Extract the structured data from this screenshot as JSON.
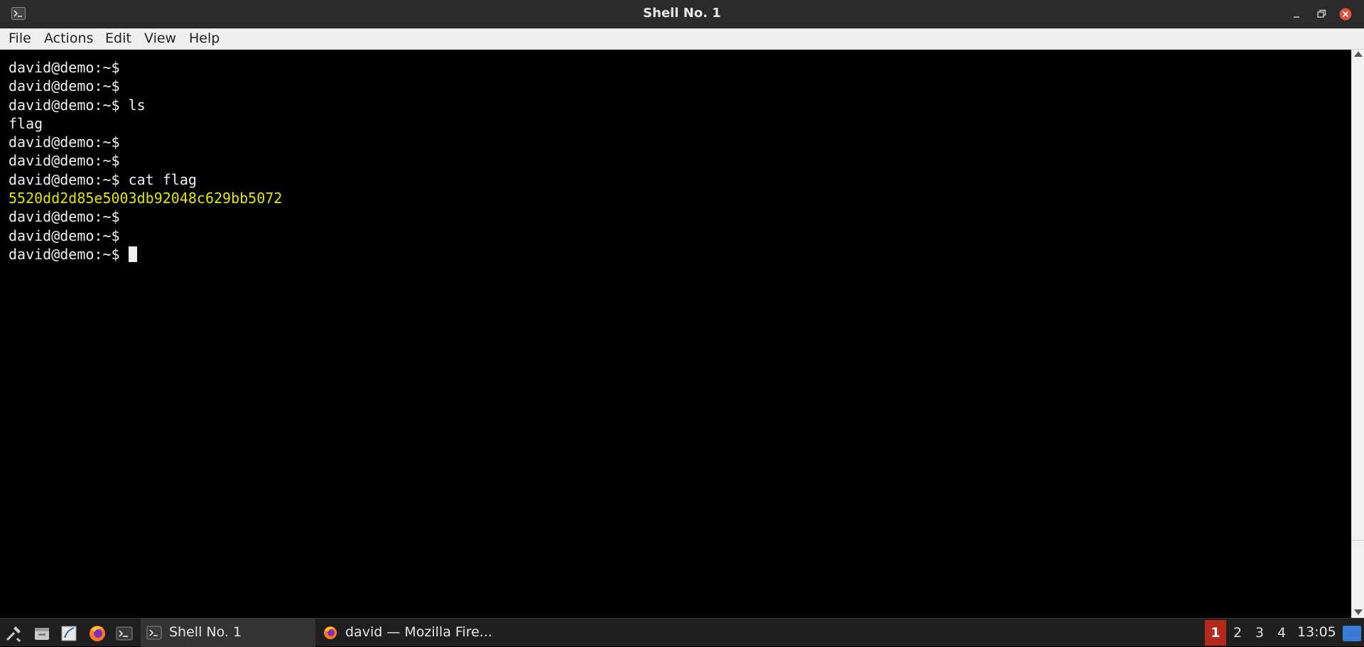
{
  "window": {
    "title": "Shell No. 1",
    "app_icon": "terminal-icon"
  },
  "menubar": {
    "items": [
      "File",
      "Actions",
      "Edit",
      "View",
      "Help"
    ]
  },
  "terminal": {
    "lines": [
      {
        "text": "david@demo:~$",
        "style": "prompt"
      },
      {
        "text": "david@demo:~$",
        "style": "prompt"
      },
      {
        "text": "david@demo:~$ ls",
        "style": "prompt"
      },
      {
        "text": "flag",
        "style": "output"
      },
      {
        "text": "david@demo:~$",
        "style": "prompt"
      },
      {
        "text": "david@demo:~$",
        "style": "prompt"
      },
      {
        "text": "david@demo:~$ cat flag",
        "style": "prompt"
      },
      {
        "text": "5520dd2d85e5003db92048c629bb5072",
        "style": "output-yellow"
      },
      {
        "text": "david@demo:~$",
        "style": "prompt"
      },
      {
        "text": "david@demo:~$",
        "style": "prompt"
      },
      {
        "text": "david@demo:~$ ",
        "style": "prompt-current"
      }
    ],
    "foreground": "#f0f0f0",
    "highlight_color": "#e5e500",
    "background": "#000000"
  },
  "taskbar": {
    "launchers": [
      "tools-icon",
      "file-manager-icon",
      "text-editor-icon",
      "firefox-icon",
      "terminal-icon"
    ],
    "tasks": [
      {
        "label": "Shell No. 1",
        "icon": "terminal-icon",
        "active": true
      },
      {
        "label": "david — Mozilla Fire...",
        "icon": "firefox-icon",
        "active": false
      }
    ],
    "workspaces": [
      "1",
      "2",
      "3",
      "4"
    ],
    "current_workspace": "1",
    "clock": "13:05",
    "accent": "#b5291c"
  }
}
